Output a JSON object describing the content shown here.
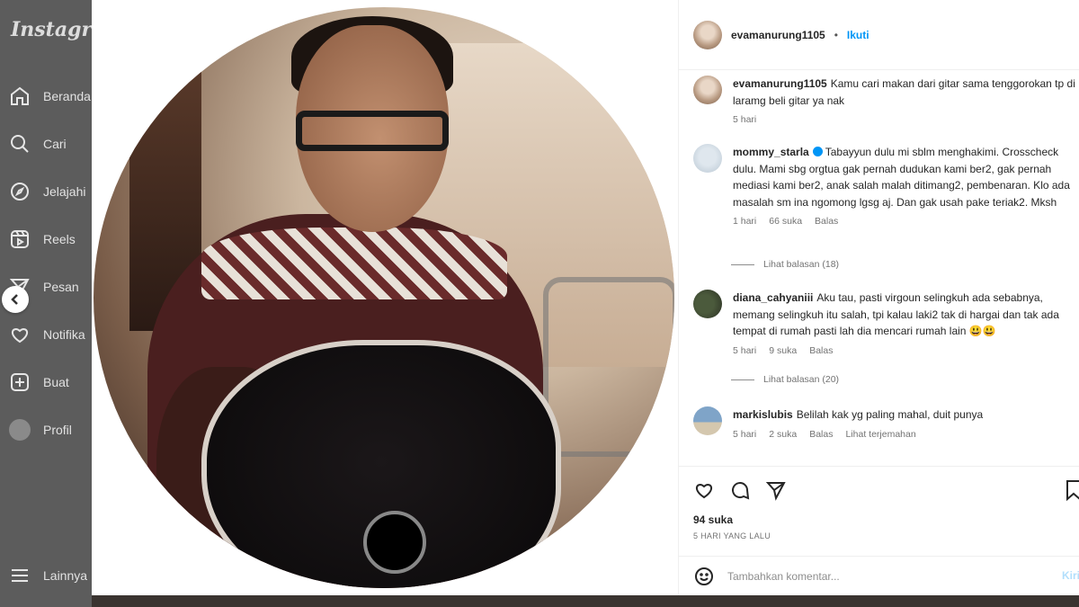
{
  "sidebar": {
    "brand": "Instagram",
    "items": [
      {
        "label": "Beranda",
        "icon": "home-icon"
      },
      {
        "label": "Cari",
        "icon": "search-icon"
      },
      {
        "label": "Jelajahi",
        "icon": "compass-icon"
      },
      {
        "label": "Reels",
        "icon": "reels-icon"
      },
      {
        "label": "Pesan",
        "icon": "send-icon"
      },
      {
        "label": "Notifika",
        "icon": "heart-icon"
      },
      {
        "label": "Buat",
        "icon": "plus-icon"
      },
      {
        "label": "Profil",
        "icon": "avatar"
      }
    ],
    "more_label": "Lainnya"
  },
  "post": {
    "author": "evamanurung1105",
    "follow_label": "Ikuti",
    "caption": {
      "user": "evamanurung1105",
      "text": "Kamu cari makan dari gitar sama tenggorokan tp di laramg beli gitar ya nak",
      "time": "5 hari"
    },
    "comments": [
      {
        "user": "mommy_starla",
        "verified": true,
        "text": "Tabayyun dulu mi sblm menghakimi. Crosscheck dulu. Mami sbg orgtua gak pernah dudukan kami ber2, gak pernah mediasi kami ber2, anak salah malah ditimang2, pembenaran. Klo ada masalah sm ina ngomong lgsg aj. Dan gak usah pake teriak2. Mksh",
        "time": "1 hari",
        "likes": "66 suka",
        "reply": "Balas",
        "view_replies": "Lihat balasan (18)"
      },
      {
        "user": "diana_cahyaniii",
        "verified": false,
        "text": "Aku tau, pasti virgoun selingkuh ada sebabnya, memang selingkuh itu salah, tpi kalau laki2 tak di hargai dan tak ada tempat di rumah pasti lah dia mencari rumah lain 😃😃",
        "time": "5 hari",
        "likes": "9 suka",
        "reply": "Balas",
        "view_replies": "Lihat balasan (20)"
      },
      {
        "user": "markislubis",
        "verified": false,
        "text": "Belilah kak yg paling mahal, duit punya",
        "time": "5 hari",
        "likes": "2 suka",
        "reply": "Balas",
        "translate": "Lihat terjemahan"
      }
    ],
    "likes_count": "94 suka",
    "posted_time": "5 HARI YANG LALU",
    "add_comment_placeholder": "Tambahkan komentar...",
    "post_label": "Kirim"
  }
}
